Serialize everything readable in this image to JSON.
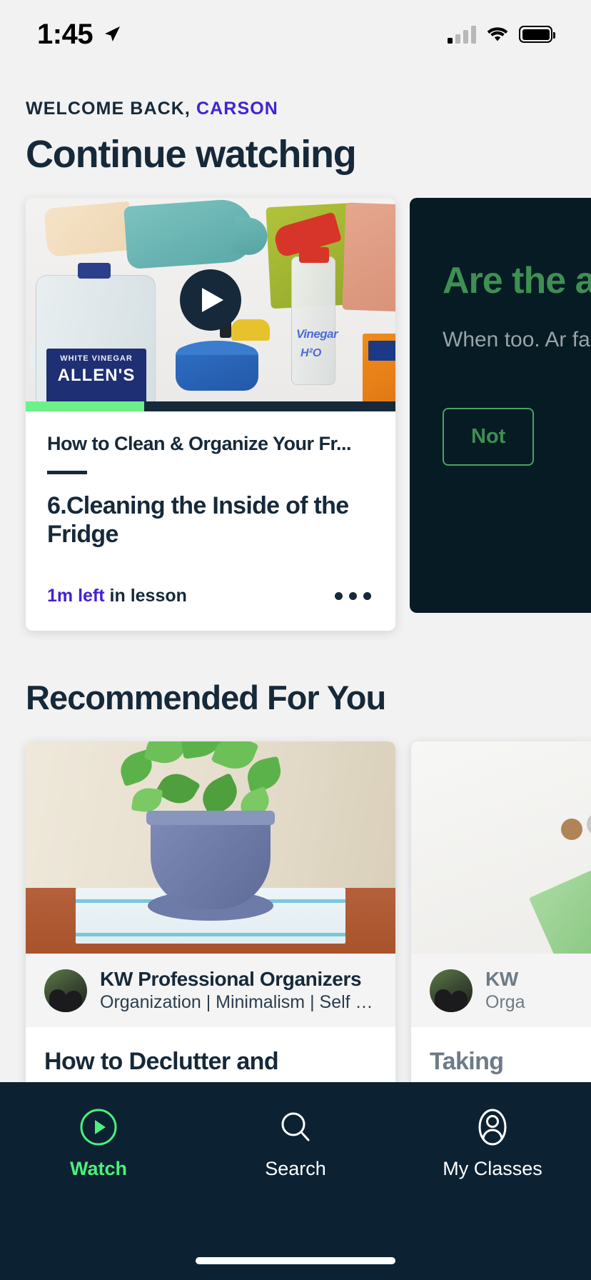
{
  "status_bar": {
    "time": "1:45",
    "location_icon": "location-arrow-icon",
    "cellular_icon": "cellular-bars-icon",
    "wifi_icon": "wifi-icon",
    "battery_icon": "battery-icon"
  },
  "header": {
    "welcome_prefix": "WELCOME BACK,",
    "user_name": "CARSON",
    "page_title": "Continue watching"
  },
  "continue_watching": {
    "lesson_card": {
      "thumbnail_alt": "cleaning supplies flat lay with vinegar jug, gloves, spray bottle, sponge and baking soda",
      "play_icon": "play-icon",
      "progress_percent": 32,
      "course_title": "How to Clean & Organize Your Fr...",
      "lesson_title": "6.Cleaning the Inside of the Fridge",
      "time_left": "1m left",
      "time_left_suffix": " in lesson",
      "more_icon": "more-options-icon"
    },
    "promo_card": {
      "title": "Are the app",
      "body": "When too. Ar far?",
      "button_label": "Not"
    }
  },
  "recommended": {
    "section_title": "Recommended For You",
    "cards": [
      {
        "thumbnail_alt": "potted ivy plant on wooden table",
        "author_name": "KW Professional Organizers",
        "author_tags": "Organization | Minimalism | Self C...",
        "title": "How to Declutter and"
      },
      {
        "thumbnail_alt": "canadian currency bills and coins",
        "author_name": "KW",
        "author_tags": "Orga",
        "title": "Taking"
      }
    ]
  },
  "tab_bar": {
    "tabs": [
      {
        "label": "Watch",
        "icon": "play-circle-icon",
        "active": true
      },
      {
        "label": "Search",
        "icon": "search-icon",
        "active": false
      },
      {
        "label": "My Classes",
        "icon": "user-circle-icon",
        "active": false
      }
    ]
  },
  "colors": {
    "accent_purple": "#4322d4",
    "accent_green": "#4cf07a",
    "dark_navy": "#16293a",
    "tabbar_bg": "#0c2233",
    "promo_bg": "#061b24",
    "promo_green": "#3f8f53",
    "page_bg": "#f2f2f2"
  }
}
